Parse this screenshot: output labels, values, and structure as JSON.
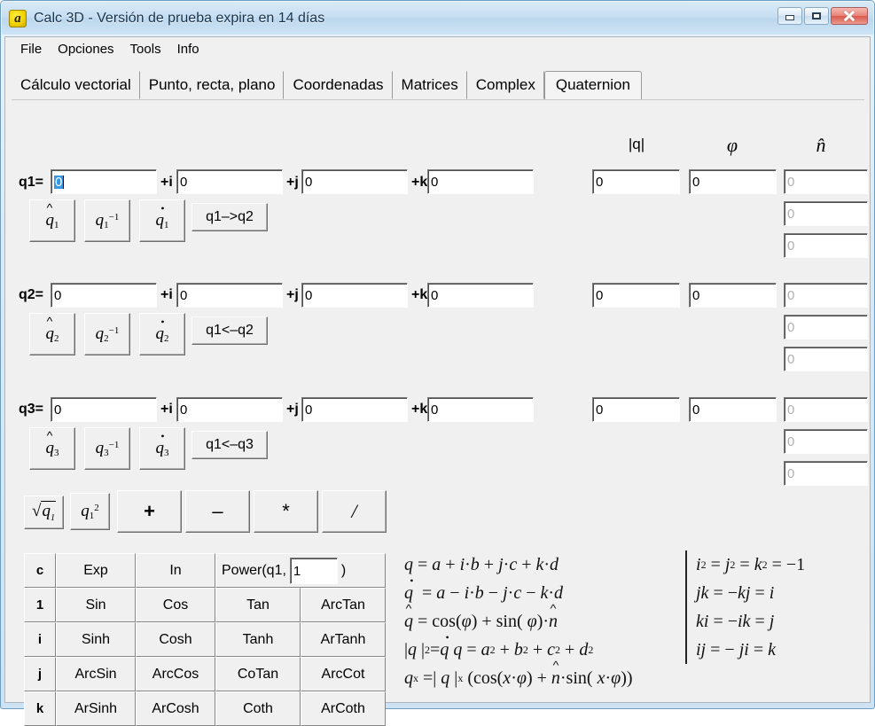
{
  "window": {
    "title": "Calc 3D - Versión de prueba expira en 14 días",
    "icon": "app-icon-a",
    "caption": {
      "minimize": "minimize-icon",
      "maximize": "maximize-icon",
      "close": "close-icon"
    }
  },
  "menu": {
    "items": [
      "File",
      "Opciones",
      "Tools",
      "Info"
    ]
  },
  "tabs": {
    "items": [
      {
        "label": "Cálculo vectorial",
        "active": false
      },
      {
        "label": "Punto, recta, plano",
        "active": false
      },
      {
        "label": "Coordenadas",
        "active": false
      },
      {
        "label": "Matrices",
        "active": false
      },
      {
        "label": "Complex",
        "active": false
      },
      {
        "label": "Quaternion",
        "active": true
      }
    ]
  },
  "columns": {
    "magnitude": "|q|",
    "phi": "φ",
    "nhat": "n̂"
  },
  "quaternions": [
    {
      "label": "q1=",
      "sep_i": "+i",
      "sep_j": "+j",
      "sep_k": "+k",
      "a": "0",
      "b": "0",
      "c": "0",
      "d": "0",
      "a_selected": true,
      "abs": "0",
      "phi": "0",
      "n": [
        "0",
        "0",
        "0"
      ],
      "buttons": {
        "unit": "q̂1",
        "inverse": "q1^-1",
        "conjugate": "q1^*",
        "transfer": "q1–>q2"
      }
    },
    {
      "label": "q2=",
      "sep_i": "+i",
      "sep_j": "+j",
      "sep_k": "+k",
      "a": "0",
      "b": "0",
      "c": "0",
      "d": "0",
      "a_selected": false,
      "abs": "0",
      "phi": "0",
      "n": [
        "0",
        "0",
        "0"
      ],
      "buttons": {
        "unit": "q̂2",
        "inverse": "q2^-1",
        "conjugate": "q2^*",
        "transfer": "q1<–q2"
      }
    },
    {
      "label": "q3=",
      "sep_i": "+i",
      "sep_j": "+j",
      "sep_k": "+k",
      "a": "0",
      "b": "0",
      "c": "0",
      "d": "0",
      "a_selected": false,
      "abs": "0",
      "phi": "0",
      "n": [
        "0",
        "0",
        "0"
      ],
      "buttons": {
        "unit": "q̂3",
        "inverse": "q3^-1",
        "conjugate": "q3^*",
        "transfer": "q1<–q3"
      }
    }
  ],
  "operators": {
    "sqrt": "√q1",
    "square": "q1²",
    "plus": "+",
    "minus": "–",
    "times": "*",
    "divide": "/"
  },
  "function_grid": {
    "rows": [
      {
        "key": "c",
        "cells": [
          "Exp",
          "In",
          "POWER"
        ]
      },
      {
        "key": "1",
        "cells": [
          "Sin",
          "Cos",
          "Tan",
          "ArcTan"
        ]
      },
      {
        "key": "i",
        "cells": [
          "Sinh",
          "Cosh",
          "Tanh",
          "ArTanh"
        ]
      },
      {
        "key": "j",
        "cells": [
          "ArcSin",
          "ArcCos",
          "CoTan",
          "ArcCot"
        ]
      },
      {
        "key": "k",
        "cells": [
          "ArSinh",
          "ArCosh",
          "Coth",
          "ArCoth"
        ]
      }
    ],
    "power": {
      "prefix": "Power(q1,",
      "value": "1",
      "suffix": ")"
    }
  },
  "formulas": {
    "left": [
      "q = a + i·b + j·c + k·d",
      "q• = a − i·b − j·c − k·d",
      "q̂ = cos(φ) + sin(φ)·n̂",
      "|q|² = q•q = a² + b² + c² + d²",
      "qˣ = |q|ˣ (cos(x·φ) + n̂·sin( x·φ))"
    ],
    "right": [
      "i² = j² = k² = −1",
      "jk = −kj = i",
      "ki = −ik = j",
      "ij = − ji = k"
    ]
  },
  "colors": {
    "selection": "#3399e6",
    "title_gradient_top": "#d9eaf7",
    "face": "#f0f0f0",
    "close_button": "#d9594c"
  }
}
